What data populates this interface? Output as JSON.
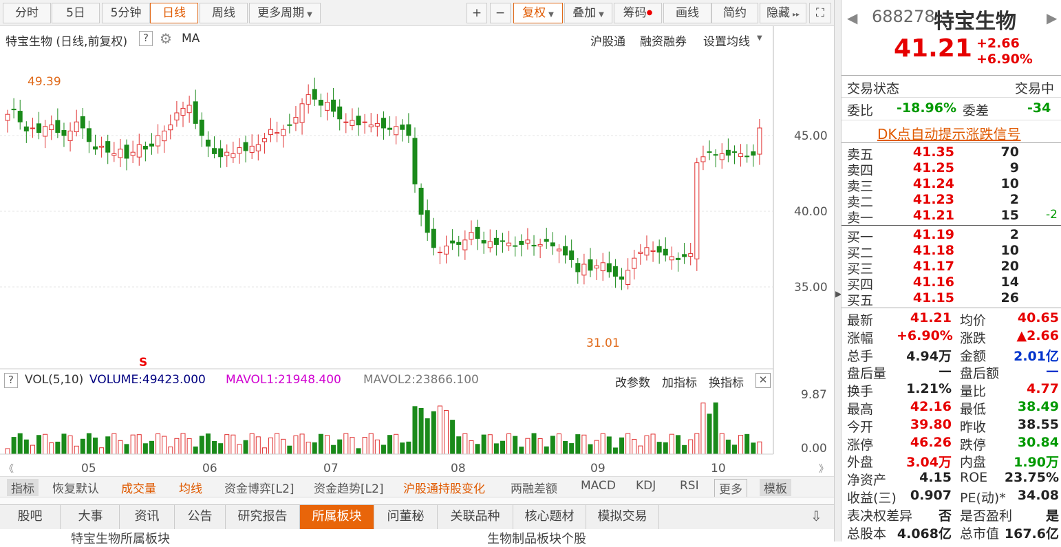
{
  "toolbar": {
    "tabs": [
      "分时",
      "5日",
      "5分钟",
      "日线",
      "周线",
      "更多周期"
    ],
    "active": "日线",
    "right": [
      "+",
      "−",
      "复权",
      "叠加",
      "筹码",
      "画线",
      "简约",
      "隐藏"
    ]
  },
  "chart_header": {
    "title": "特宝生物 (日线,前复权)",
    "help": "?",
    "ma": "MA",
    "links": [
      "沪股通",
      "融资融券",
      "设置均线"
    ]
  },
  "price_axis": [
    "45.00",
    "40.00",
    "35.00"
  ],
  "annotations": {
    "high": "49.39",
    "low": "31.01",
    "s_mark": "S"
  },
  "vol_header": {
    "text": "VOL(5,10)",
    "volume": "VOLUME:49423.000",
    "mavol1": "MAVOL1:21948.400",
    "mavol2": "MAVOL2:23866.100",
    "links": [
      "改参数",
      "加指标",
      "换指标"
    ]
  },
  "vol_axis": [
    "9.87",
    "0.00"
  ],
  "month_labels": [
    "05",
    "06",
    "07",
    "08",
    "09",
    "10"
  ],
  "indicator_tabs": [
    "指标",
    "恢复默认",
    "成交量",
    "均线",
    "资金博弈[L2]",
    "资金趋势[L2]",
    "沪股通持股变化",
    "两融差额",
    "MACD",
    "KDJ",
    "RSI",
    "更多",
    "模板"
  ],
  "bottom_tabs": [
    "股吧",
    "大事",
    "资讯",
    "公告",
    "研究报告",
    "所属板块",
    "问董秘",
    "关联品种",
    "核心题材",
    "模拟交易"
  ],
  "bottom_active": "所属板块",
  "bottom_sub": [
    "特宝生物所属板块",
    "生物制品板块个股"
  ],
  "quote": {
    "code": "688278",
    "name": "特宝生物",
    "price": "41.21",
    "change": "+2.66",
    "pct": "+6.90%"
  },
  "status": {
    "label": "交易状态",
    "value": "交易中"
  },
  "weibi": {
    "label1": "委比",
    "v1": "-18.96%",
    "label2": "委差",
    "v2": "-34"
  },
  "dk": "DK点自动提示涨跌信号",
  "asks": [
    {
      "l": "卖五",
      "p": "41.35",
      "v": "70"
    },
    {
      "l": "卖四",
      "p": "41.25",
      "v": "9"
    },
    {
      "l": "卖三",
      "p": "41.24",
      "v": "10"
    },
    {
      "l": "卖二",
      "p": "41.23",
      "v": "2"
    },
    {
      "l": "卖一",
      "p": "41.21",
      "v": "15",
      "d": "-2"
    }
  ],
  "bids": [
    {
      "l": "买一",
      "p": "41.19",
      "v": "2"
    },
    {
      "l": "买二",
      "p": "41.18",
      "v": "10"
    },
    {
      "l": "买三",
      "p": "41.17",
      "v": "20"
    },
    {
      "l": "买四",
      "p": "41.16",
      "v": "14"
    },
    {
      "l": "买五",
      "p": "41.15",
      "v": "26"
    }
  ],
  "stats": [
    [
      "最新",
      "41.21",
      "均价",
      "40.65"
    ],
    [
      "涨幅",
      "+6.90%",
      "涨跌",
      "▲2.66"
    ],
    [
      "总手",
      "4.94万",
      "金额",
      "2.01亿"
    ],
    [
      "盘后量",
      "—",
      "盘后额",
      "—"
    ],
    [
      "换手",
      "1.21%",
      "量比",
      "4.77"
    ],
    [
      "最高",
      "42.16",
      "最低",
      "38.49"
    ],
    [
      "今开",
      "39.80",
      "昨收",
      "38.55"
    ],
    [
      "涨停",
      "46.26",
      "跌停",
      "30.84"
    ],
    [
      "外盘",
      "3.04万",
      "内盘",
      "1.90万"
    ],
    [
      "净资产",
      "4.15",
      "ROE",
      "23.75%"
    ],
    [
      "收益(三)",
      "0.907",
      "PE(动)*",
      "34.08"
    ],
    [
      "表决权差异",
      "否",
      "是否盈利",
      "是"
    ],
    [
      "总股本",
      "4.068亿",
      "总市值",
      "167.6亿"
    ]
  ],
  "stat_colors": [
    [
      "red",
      "red"
    ],
    [
      "red",
      "red"
    ],
    [
      "#222",
      "blue"
    ],
    [
      "#222",
      "blue"
    ],
    [
      "#222",
      "red"
    ],
    [
      "red",
      "green"
    ],
    [
      "red",
      "#222"
    ],
    [
      "red",
      "green"
    ],
    [
      "red",
      "green"
    ],
    [
      "#222",
      "#222"
    ],
    [
      "#222",
      "#222"
    ],
    [
      "#222",
      "#222"
    ],
    [
      "#222",
      "#222"
    ]
  ],
  "colors": {
    "up": "#e03030",
    "down": "#1a8a1a",
    "accent": "#e8650a"
  },
  "chart_data": {
    "type": "candlestick",
    "ylim": [
      30.5,
      49.5
    ],
    "y_ticks": [
      45,
      40,
      35
    ],
    "x_labels": [
      "05",
      "06",
      "07",
      "08",
      "09",
      "10"
    ],
    "high": 49.39,
    "low": 31.01
  }
}
